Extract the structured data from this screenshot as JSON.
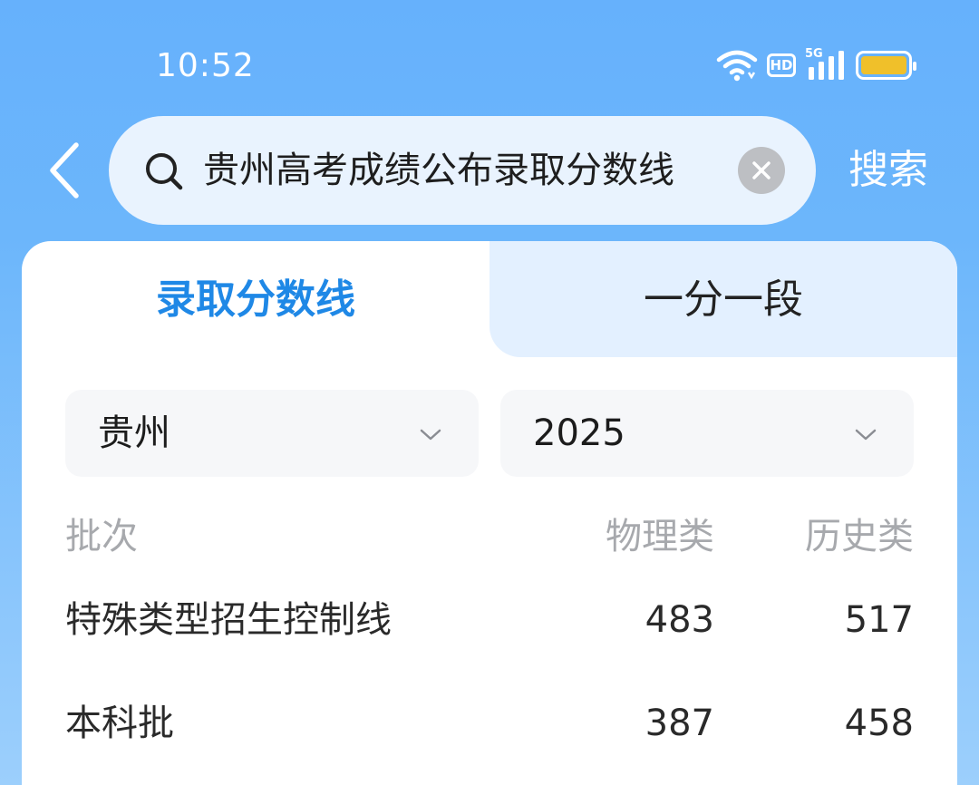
{
  "status_bar": {
    "time": "10:52",
    "hd_label": "HD",
    "network_label": "5G",
    "battery_color": "#f0c02a"
  },
  "search_bar": {
    "query": "贵州高考成绩公布录取分数线",
    "submit_label": "搜索",
    "icons": [
      "back-icon",
      "search-icon",
      "clear-icon"
    ]
  },
  "tabs": [
    {
      "label": "录取分数线",
      "active": true
    },
    {
      "label": "一分一段",
      "active": false
    }
  ],
  "filters": {
    "province": "贵州",
    "year": "2025"
  },
  "table": {
    "headers": [
      "批次",
      "物理类",
      "历史类"
    ],
    "rows": [
      {
        "batch": "特殊类型招生控制线",
        "physics": "483",
        "history": "517"
      },
      {
        "batch": "本科批",
        "physics": "387",
        "history": "458"
      }
    ]
  },
  "colors": {
    "header_bg": "#66b1fc",
    "accent": "#1f88e6",
    "inactive_tab_bg": "#e3f0ff"
  }
}
